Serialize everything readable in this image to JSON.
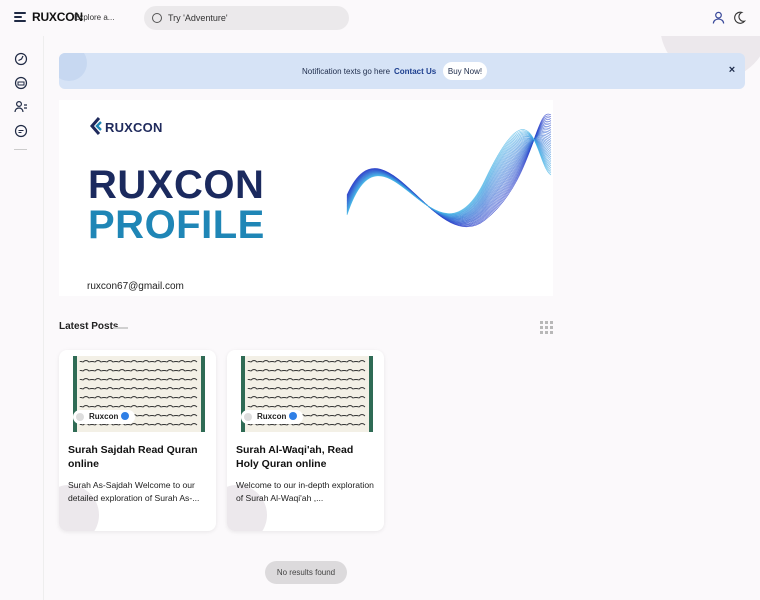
{
  "header": {
    "logo": "RUXCON",
    "tagline": "Explore a...",
    "search_placeholder": "Try 'Adventure'"
  },
  "notification": {
    "text": "Notification texts go here",
    "link": "Contact Us",
    "button": "Buy Now!",
    "close": "×"
  },
  "banner": {
    "logo": "RUXCON",
    "title_line1": "RUXCON",
    "title_line2": "PROFILE",
    "email": "ruxcon67@gmail.com"
  },
  "section": {
    "title": "Latest Posts"
  },
  "posts": [
    {
      "author": "Ruxcon",
      "title": "Surah Sajdah Read Quran online",
      "excerpt": "Surah As-Sajdah Welcome to our detailed exploration of Surah As-..."
    },
    {
      "author": "Ruxcon",
      "title": "Surah Al-Waqi'ah, Read Holy Quran online",
      "excerpt": "Welcome to our in-depth exploration of Surah Al-Waqi'ah ,..."
    }
  ],
  "status": {
    "no_results": "No results found"
  },
  "colors": {
    "brand_dark": "#1b2a5e",
    "brand_light": "#1f86b6",
    "notification_bg": "#d6e3f6"
  },
  "icons": [
    "menu-icon",
    "search-icon",
    "user-icon",
    "moon-icon",
    "compass-icon",
    "folder-icon",
    "users-icon",
    "chat-icon",
    "grid-icon",
    "close-icon",
    "verified-icon"
  ]
}
